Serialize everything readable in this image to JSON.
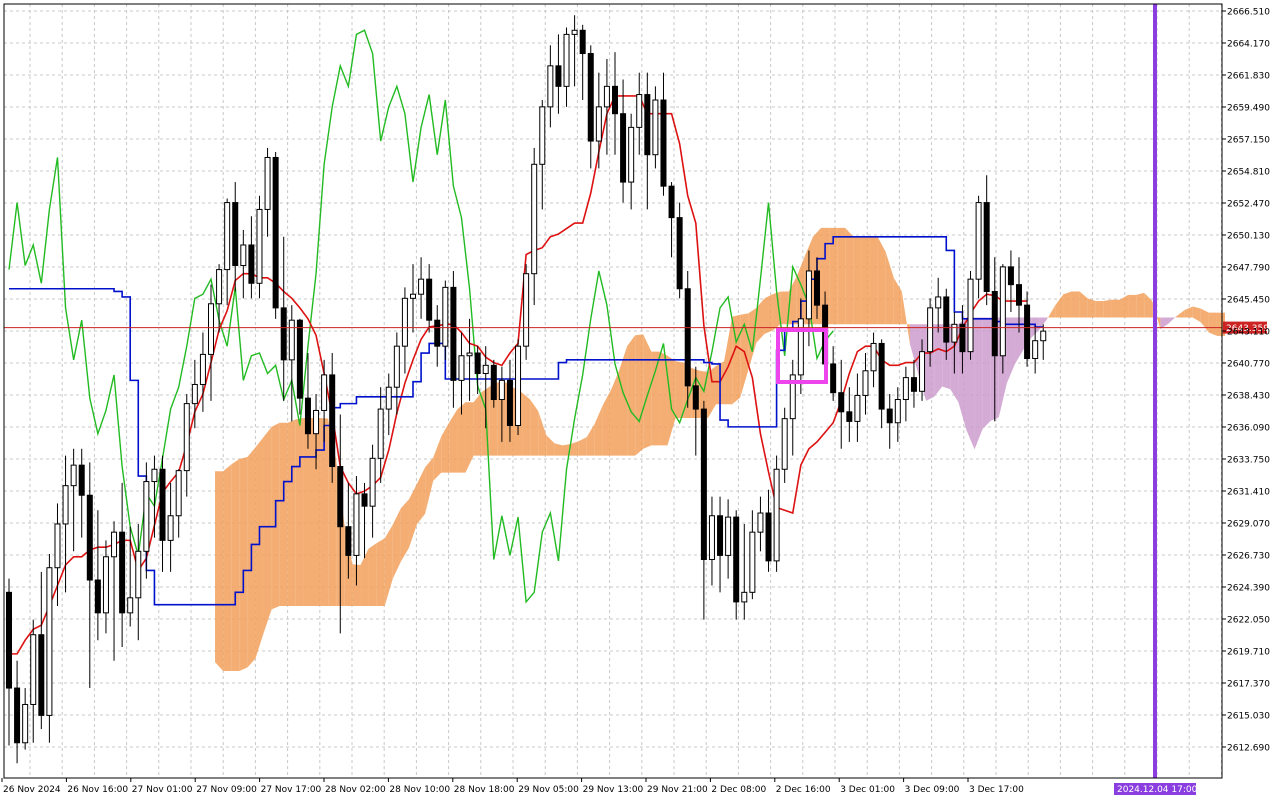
{
  "chart_data": {
    "type": "candlestick",
    "instrument_context": "Gold CFD intraday (MetaTrader style) with Ichimoku Kinko Hyo",
    "y_axis": {
      "range": [
        2610.2,
        2667.6
      ],
      "tick_labels": [
        "2666.510",
        "2664.170",
        "2661.830",
        "2659.490",
        "2657.150",
        "2654.810",
        "2652.470",
        "2650.130",
        "2647.790",
        "2645.450",
        "2643.110",
        "2640.770",
        "2638.430",
        "2636.090",
        "2633.750",
        "2631.410",
        "2629.070",
        "2626.730",
        "2624.390",
        "2622.050",
        "2619.710",
        "2617.370",
        "2615.030",
        "2612.690"
      ],
      "position": "right"
    },
    "x_axis": {
      "tick_labels": [
        "26 Nov 2024",
        "26 Nov 16:00",
        "27 Nov 01:00",
        "27 Nov 09:00",
        "27 Nov 17:00",
        "28 Nov 02:00",
        "28 Nov 10:00",
        "28 Nov 18:00",
        "29 Nov 05:00",
        "29 Nov 13:00",
        "29 Nov 21:00",
        "2 Dec 08:00",
        "2 Dec 16:00",
        "3 Dec 01:00",
        "3 Dec 09:00",
        "3 Dec 17:00"
      ],
      "future_marker": "2024.12.04 17:00"
    },
    "grid": true,
    "current_price": {
      "value": 2643.359,
      "label": "2643.359",
      "color": "#cc2222"
    },
    "colors": {
      "bull_body": "#ffffff",
      "bear_body": "#000000",
      "tenkan": "#dd1111",
      "kijun": "#0011cc",
      "chikou": "#22bb22",
      "kumo_bear": "#cc9ccc",
      "kumo_bull": "#f2a05a",
      "marker_box": "#ee44ee",
      "vertical_marker": "#8a3ee0"
    },
    "candles": [
      [
        2624.0,
        2625.0,
        2612.8,
        2617.0
      ],
      [
        2617.0,
        2619.0,
        2611.5,
        2613.0
      ],
      [
        2613.0,
        2617.0,
        2612.5,
        2615.8
      ],
      [
        2615.8,
        2622.0,
        2613.0,
        2620.9
      ],
      [
        2620.9,
        2625.5,
        2614.0,
        2615.0
      ],
      [
        2615.0,
        2626.8,
        2613.0,
        2625.8
      ],
      [
        2625.8,
        2630.5,
        2623.0,
        2629.0
      ],
      [
        2629.0,
        2634.0,
        2624.0,
        2631.8
      ],
      [
        2631.8,
        2634.5,
        2627.0,
        2633.3
      ],
      [
        2633.3,
        2634.5,
        2628.0,
        2631.1
      ],
      [
        2631.1,
        2633.5,
        2617.0,
        2624.9
      ],
      [
        2624.9,
        2630.0,
        2620.5,
        2622.5
      ],
      [
        2622.5,
        2627.8,
        2621.0,
        2626.6
      ],
      [
        2626.6,
        2629.2,
        2619.0,
        2628.4
      ],
      [
        2628.4,
        2632.0,
        2620.0,
        2622.5
      ],
      [
        2622.5,
        2628.8,
        2621.5,
        2623.6
      ],
      [
        2623.6,
        2629.0,
        2620.5,
        2627.0
      ],
      [
        2627.0,
        2633.5,
        2625.0,
        2632.1
      ],
      [
        2632.1,
        2634.0,
        2628.0,
        2633.0
      ],
      [
        2633.0,
        2634.0,
        2625.5,
        2627.8
      ],
      [
        2627.8,
        2632.0,
        2625.5,
        2629.6
      ],
      [
        2629.6,
        2633.0,
        2628.0,
        2632.9
      ],
      [
        2632.9,
        2638.5,
        2631.0,
        2637.8
      ],
      [
        2637.8,
        2641.0,
        2636.0,
        2639.2
      ],
      [
        2639.2,
        2643.0,
        2637.2,
        2641.4
      ],
      [
        2641.4,
        2646.5,
        2638.0,
        2645.1
      ],
      [
        2645.1,
        2648.0,
        2643.0,
        2647.6
      ],
      [
        2647.6,
        2652.8,
        2645.0,
        2652.5
      ],
      [
        2652.5,
        2654.0,
        2646.0,
        2647.9
      ],
      [
        2647.9,
        2650.5,
        2645.5,
        2649.4
      ],
      [
        2649.4,
        2651.5,
        2645.5,
        2646.6
      ],
      [
        2646.6,
        2653.0,
        2645.5,
        2652.0
      ],
      [
        2652.0,
        2656.5,
        2650.0,
        2655.8
      ],
      [
        2655.8,
        2656.2,
        2644.0,
        2644.8
      ],
      [
        2644.8,
        2650.0,
        2638.0,
        2641.0
      ],
      [
        2641.0,
        2645.0,
        2636.5,
        2643.9
      ],
      [
        2643.9,
        2644.0,
        2637.0,
        2638.2
      ],
      [
        2638.2,
        2641.5,
        2634.5,
        2635.6
      ],
      [
        2635.6,
        2638.5,
        2633.0,
        2637.3
      ],
      [
        2637.3,
        2641.0,
        2635.0,
        2639.9
      ],
      [
        2639.9,
        2641.5,
        2632.0,
        2633.2
      ],
      [
        2633.2,
        2637.0,
        2621.0,
        2628.8
      ],
      [
        2628.8,
        2632.0,
        2625.0,
        2626.7
      ],
      [
        2626.7,
        2632.5,
        2624.5,
        2631.2
      ],
      [
        2631.2,
        2632.0,
        2626.5,
        2630.3
      ],
      [
        2630.3,
        2634.8,
        2628.0,
        2633.8
      ],
      [
        2633.8,
        2639.0,
        2632.0,
        2637.4
      ],
      [
        2637.4,
        2640.0,
        2635.5,
        2639.0
      ],
      [
        2639.0,
        2643.0,
        2637.0,
        2642.0
      ],
      [
        2642.0,
        2646.3,
        2640.0,
        2645.5
      ],
      [
        2645.5,
        2648.0,
        2643.0,
        2645.8
      ],
      [
        2645.8,
        2648.5,
        2644.0,
        2646.9
      ],
      [
        2646.9,
        2648.0,
        2643.0,
        2643.9
      ],
      [
        2643.9,
        2645.0,
        2640.5,
        2642.0
      ],
      [
        2642.0,
        2646.8,
        2641.0,
        2646.3
      ],
      [
        2646.3,
        2647.5,
        2637.5,
        2639.5
      ],
      [
        2639.5,
        2643.0,
        2637.0,
        2641.3
      ],
      [
        2641.3,
        2644.0,
        2638.0,
        2641.5
      ],
      [
        2641.5,
        2642.0,
        2638.5,
        2640.0
      ],
      [
        2640.0,
        2642.0,
        2636.0,
        2640.6
      ],
      [
        2640.6,
        2641.0,
        2637.5,
        2638.1
      ],
      [
        2638.1,
        2640.5,
        2635.0,
        2639.5
      ],
      [
        2639.5,
        2641.0,
        2635.0,
        2636.2
      ],
      [
        2636.2,
        2642.5,
        2635.5,
        2642.0
      ],
      [
        2642.0,
        2648.0,
        2641.0,
        2647.3
      ],
      [
        2647.3,
        2656.5,
        2645.0,
        2655.3
      ],
      [
        2655.3,
        2660.0,
        2652.0,
        2659.5
      ],
      [
        2659.5,
        2664.0,
        2658.0,
        2662.5
      ],
      [
        2662.5,
        2664.8,
        2659.0,
        2661.0
      ],
      [
        2661.0,
        2665.3,
        2659.5,
        2664.8
      ],
      [
        2664.8,
        2666.2,
        2661.0,
        2665.1
      ],
      [
        2665.1,
        2665.5,
        2660.0,
        2663.4
      ],
      [
        2663.4,
        2664.0,
        2655.0,
        2657.0
      ],
      [
        2657.0,
        2662.0,
        2655.0,
        2659.5
      ],
      [
        2659.5,
        2663.0,
        2656.0,
        2661.0
      ],
      [
        2661.0,
        2663.5,
        2656.0,
        2659.0
      ],
      [
        2659.0,
        2661.5,
        2652.5,
        2654.0
      ],
      [
        2654.0,
        2659.0,
        2652.0,
        2658.0
      ],
      [
        2658.0,
        2662.0,
        2656.0,
        2660.4
      ],
      [
        2660.4,
        2662.0,
        2652.0,
        2656.0
      ],
      [
        2656.0,
        2661.0,
        2655.0,
        2660.0
      ],
      [
        2660.0,
        2662.0,
        2653.0,
        2653.7
      ],
      [
        2653.7,
        2654.0,
        2648.5,
        2651.4
      ],
      [
        2651.4,
        2652.5,
        2645.5,
        2646.2
      ],
      [
        2646.2,
        2647.5,
        2637.5,
        2639.1
      ],
      [
        2639.1,
        2640.5,
        2634.0,
        2637.4
      ],
      [
        2637.4,
        2638.0,
        2622.0,
        2626.4
      ],
      [
        2626.4,
        2631.0,
        2624.5,
        2629.6
      ],
      [
        2629.6,
        2631.0,
        2624.0,
        2626.7
      ],
      [
        2626.7,
        2630.8,
        2625.0,
        2629.5
      ],
      [
        2629.5,
        2630.0,
        2622.0,
        2623.3
      ],
      [
        2623.3,
        2629.0,
        2622.0,
        2624.0
      ],
      [
        2624.0,
        2630.0,
        2623.5,
        2628.4
      ],
      [
        2628.4,
        2631.0,
        2627.0,
        2629.8
      ],
      [
        2629.8,
        2631.5,
        2625.5,
        2626.3
      ],
      [
        2626.3,
        2634.0,
        2625.5,
        2633.0
      ],
      [
        2633.0,
        2637.5,
        2632.0,
        2636.7
      ],
      [
        2636.7,
        2641.0,
        2634.0,
        2639.9
      ],
      [
        2639.9,
        2645.5,
        2638.5,
        2644.0
      ],
      [
        2644.0,
        2649.0,
        2642.0,
        2647.5
      ],
      [
        2647.5,
        2648.5,
        2644.0,
        2645.0
      ],
      [
        2645.0,
        2646.0,
        2639.5,
        2640.7
      ],
      [
        2640.7,
        2642.0,
        2638.0,
        2638.6
      ],
      [
        2638.6,
        2641.0,
        2634.5,
        2637.2
      ],
      [
        2637.2,
        2639.0,
        2635.0,
        2636.5
      ],
      [
        2636.5,
        2640.0,
        2635.0,
        2638.4
      ],
      [
        2638.4,
        2641.5,
        2637.0,
        2640.2
      ],
      [
        2640.2,
        2643.0,
        2639.0,
        2642.2
      ],
      [
        2642.2,
        2642.5,
        2636.0,
        2637.4
      ],
      [
        2637.4,
        2638.5,
        2634.5,
        2636.4
      ],
      [
        2636.4,
        2639.0,
        2635.0,
        2638.1
      ],
      [
        2638.1,
        2640.5,
        2636.5,
        2639.7
      ],
      [
        2639.7,
        2641.0,
        2637.5,
        2638.7
      ],
      [
        2638.7,
        2642.5,
        2638.0,
        2641.6
      ],
      [
        2641.6,
        2645.5,
        2640.5,
        2644.8
      ],
      [
        2644.8,
        2647.0,
        2643.0,
        2645.6
      ],
      [
        2645.6,
        2646.2,
        2641.0,
        2642.3
      ],
      [
        2642.3,
        2644.5,
        2640.0,
        2643.6
      ],
      [
        2643.6,
        2645.0,
        2640.0,
        2641.6
      ],
      [
        2641.6,
        2647.5,
        2641.0,
        2646.9
      ],
      [
        2646.9,
        2653.0,
        2645.5,
        2652.5
      ],
      [
        2652.5,
        2654.5,
        2645.0,
        2646.0
      ],
      [
        2646.0,
        2648.5,
        2636.5,
        2641.3
      ],
      [
        2641.3,
        2648.0,
        2640.0,
        2647.8
      ],
      [
        2647.8,
        2649.0,
        2644.5,
        2646.5
      ],
      [
        2646.5,
        2648.5,
        2643.0,
        2645.0
      ],
      [
        2645.0,
        2646.0,
        2640.5,
        2641.1
      ],
      [
        2641.1,
        2643.5,
        2640.0,
        2642.4
      ],
      [
        2642.4,
        2643.6,
        2641.0,
        2643.1
      ]
    ],
    "tenkan": [
      2619.5,
      2619.5,
      2620.5,
      2621.3,
      2621.6,
      2623.0,
      2624.5,
      2626.0,
      2626.6,
      2626.6,
      2627.1,
      2627.3,
      2627.3,
      2627.5,
      2627.8,
      2627.8,
      2625.6,
      2626.5,
      2628.9,
      2631.3,
      2632.1,
      2632.8,
      2634.8,
      2637.2,
      2638.5,
      2640.8,
      2643.2,
      2644.6,
      2646.8,
      2647.3,
      2647.3,
      2647.0,
      2647.0,
      2646.6,
      2646.0,
      2645.5,
      2644.8,
      2644.0,
      2642.8,
      2640.0,
      2637.0,
      2633.2,
      2632.0,
      2631.2,
      2631.4,
      2631.8,
      2632.4,
      2634.4,
      2637.1,
      2639.3,
      2641.0,
      2642.5,
      2643.4,
      2643.5,
      2643.6,
      2643.6,
      2643.0,
      2642.2,
      2642.0,
      2641.2,
      2640.8,
      2640.6,
      2641.5,
      2642.2,
      2648.7,
      2649.0,
      2649.2,
      2650.0,
      2650.2,
      2650.6,
      2651.0,
      2651.0,
      2653.2,
      2656.2,
      2659.0,
      2660.3,
      2660.3,
      2660.3,
      2660.3,
      2659.0,
      2659.0,
      2659.0,
      2659.0,
      2656.8,
      2653.0,
      2651.0,
      2643.5,
      2639.4,
      2639.4,
      2640.5,
      2642.0,
      2641.6,
      2639.7,
      2635.6,
      2632.8,
      2630.2,
      2630.0,
      2629.8,
      2633.3,
      2634.5,
      2635.0,
      2635.7,
      2636.4,
      2638.0,
      2640.0,
      2641.6,
      2642.0,
      2642.0,
      2641.0,
      2640.6,
      2640.6,
      2640.8,
      2640.8,
      2641.5,
      2641.5,
      2641.8,
      2641.6,
      2642.0,
      2643.3,
      2644.4,
      2645.3,
      2645.8,
      2645.7,
      2645.3,
      2645.3,
      2645.3,
      2645.3
    ],
    "kijun": [
      2646.2,
      2646.2,
      2646.2,
      2646.2,
      2646.2,
      2646.2,
      2646.2,
      2646.2,
      2646.2,
      2646.2,
      2646.2,
      2646.2,
      2646.2,
      2646.0,
      2645.6,
      2639.5,
      2632.5,
      2625.6,
      2623.1,
      2623.1,
      2623.1,
      2623.1,
      2623.1,
      2623.1,
      2623.1,
      2623.1,
      2623.1,
      2623.1,
      2624.0,
      2625.6,
      2627.5,
      2628.8,
      2628.8,
      2630.7,
      2632.1,
      2633.2,
      2633.9,
      2633.9,
      2634.4,
      2636.2,
      2637.5,
      2637.8,
      2637.8,
      2638.3,
      2638.3,
      2638.3,
      2638.3,
      2638.3,
      2638.3,
      2638.3,
      2639.4,
      2641.5,
      2642.2,
      2642.2,
      2639.6,
      2639.6,
      2639.6,
      2639.6,
      2639.6,
      2639.6,
      2639.6,
      2639.6,
      2639.6,
      2639.6,
      2639.6,
      2639.6,
      2639.6,
      2639.6,
      2640.8,
      2641.0,
      2641.0,
      2641.0,
      2641.0,
      2641.0,
      2641.0,
      2641.0,
      2641.0,
      2641.0,
      2641.0,
      2641.0,
      2641.0,
      2641.0,
      2641.0,
      2641.0,
      2641.0,
      2641.0,
      2640.8,
      2640.7,
      2636.6,
      2636.1,
      2636.1,
      2636.1,
      2636.1,
      2636.1,
      2636.1,
      2641.7,
      2643.1,
      2643.8,
      2645.3,
      2646.9,
      2648.4,
      2649.5,
      2650.0,
      2650.0,
      2650.0,
      2650.0,
      2650.0,
      2650.0,
      2650.0,
      2650.0,
      2650.0,
      2650.0,
      2650.0,
      2650.0,
      2650.0,
      2650.0,
      2649.0,
      2644.5,
      2644.0,
      2644.0,
      2644.0,
      2644.0,
      2643.8,
      2643.6,
      2643.6,
      2643.6,
      2643.6,
      2643.4,
      2643.4,
      2643.4,
      2642.0,
      2642.0,
      2642.0,
      2642.0,
      2642.0,
      2641.2,
      2640.0,
      2640.0,
      2640.0,
      2640.0,
      2637.2,
      2637.2,
      2637.2,
      2637.2,
      2637.2,
      2637.2,
      2637.2,
      2637.2,
      2637.2,
      2637.2,
      2637.2,
      2637.2,
      2637.2,
      2637.2,
      2637.2,
      2638.3,
      2639.9,
      2641.6,
      2643.0,
      2643.7,
      2643.7,
      2643.7,
      2643.7,
      2643.9,
      2643.9,
      2643.9,
      2643.9,
      2643.9,
      2643.9,
      2644.2
    ]
  }
}
